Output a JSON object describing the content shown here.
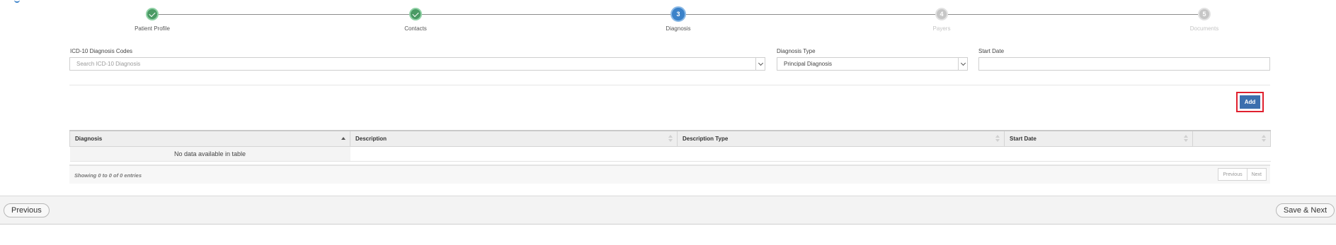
{
  "wizard": {
    "steps": [
      {
        "label": "Patient Profile",
        "number": "1",
        "state": "done"
      },
      {
        "label": "Contacts",
        "number": "2",
        "state": "done"
      },
      {
        "label": "Diagnosis",
        "number": "3",
        "state": "active"
      },
      {
        "label": "Payers",
        "number": "4",
        "state": "todo"
      },
      {
        "label": "Documents",
        "number": "5",
        "state": "todo"
      }
    ]
  },
  "form": {
    "icd_label": "ICD-10 Diagnosis Codes",
    "icd_placeholder": "Search ICD-10 Diagnosis",
    "type_label": "Diagnosis Type",
    "type_value": "Principal Diagnosis",
    "start_label": "Start Date",
    "start_value": "",
    "add_label": "Add"
  },
  "table": {
    "columns": [
      "Diagnosis",
      "Description",
      "Description Type",
      "Start Date",
      ""
    ],
    "empty_text": "No data available in table",
    "info": "Showing 0 to 0 of 0 entries",
    "prev_label": "Previous",
    "next_label": "Next"
  },
  "nav": {
    "previous_label": "Previous",
    "save_next_label": "Save & Next"
  },
  "colors": {
    "done": "#4a9a64",
    "active": "#3b82c9",
    "todo": "#c6c6c6",
    "add_button": "#3c6fae",
    "highlight": "#e0202e"
  }
}
